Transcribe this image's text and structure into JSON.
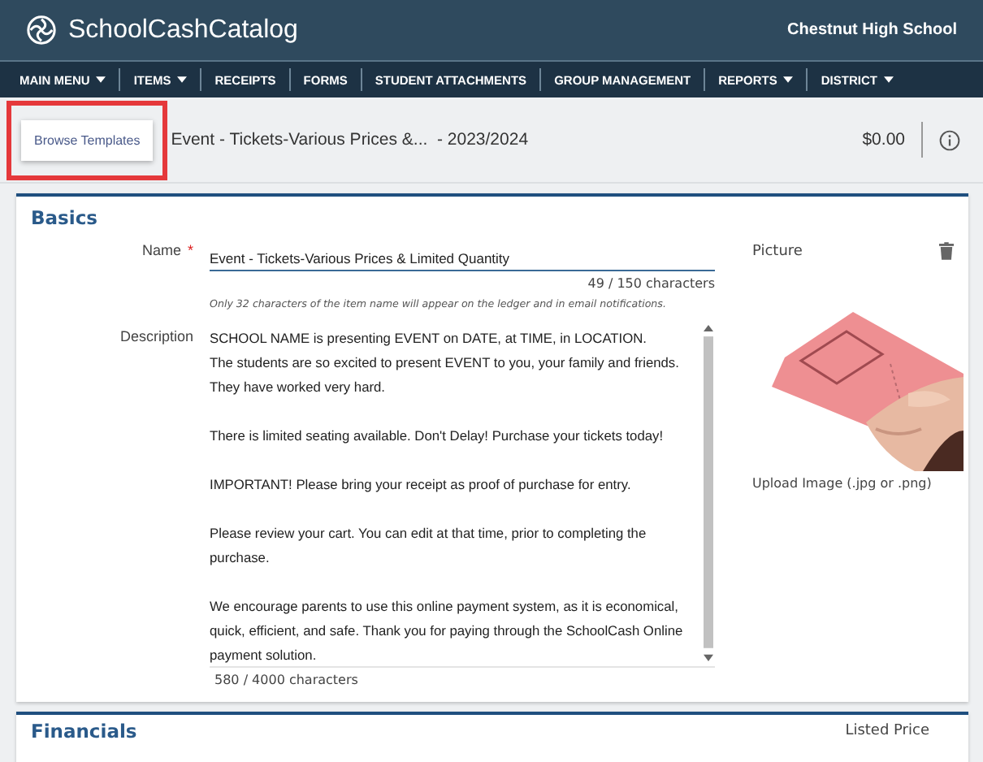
{
  "header": {
    "brand": "SchoolCashCatalog",
    "school": "Chestnut High School"
  },
  "nav": [
    {
      "label": "MAIN MENU",
      "dropdown": true
    },
    {
      "label": "ITEMS",
      "dropdown": true
    },
    {
      "label": "RECEIPTS",
      "dropdown": false
    },
    {
      "label": "FORMS",
      "dropdown": false
    },
    {
      "label": "STUDENT ATTACHMENTS",
      "dropdown": false
    },
    {
      "label": "GROUP MANAGEMENT",
      "dropdown": false
    },
    {
      "label": "REPORTS",
      "dropdown": true
    },
    {
      "label": "DISTRICT",
      "dropdown": true
    }
  ],
  "toolbar": {
    "browse_button": "Browse Templates",
    "highlighted": true,
    "item_title": "Event - Tickets-Various Prices &...  - 2023/2024",
    "total": "$0.00"
  },
  "basics": {
    "title": "Basics",
    "name_label": "Name",
    "required_mark": "*",
    "name_value": "Event - Tickets-Various Prices & Limited Quantity",
    "name_count": "49 / 150  characters",
    "name_hint": "Only 32 characters of the item name will appear on the ledger and in email notifications.",
    "description_label": "Description",
    "description_paragraphs": [
      [
        "SCHOOL NAME is presenting EVENT  on DATE, at TIME, in LOCATION.",
        "The students are so excited to present EVENT to you, your family and friends.",
        "They have worked very hard."
      ],
      [
        "There is limited seating available. Don't Delay! Purchase your tickets today!"
      ],
      [
        "IMPORTANT! Please bring your receipt as proof of purchase for entry."
      ],
      [
        "Please review your cart. You can edit at that time, prior to completing the",
        "purchase."
      ],
      [
        "We encourage parents to use this online payment system, as it is economical,",
        "quick, efficient, and safe. Thank you for paying through the SchoolCash Online",
        "payment solution."
      ]
    ],
    "description_count": "580 / 4000  characters",
    "picture_label": "Picture",
    "picture": {
      "kind": "picture"
    },
    "upload_hint": "Upload Image (.jpg or .png)"
  },
  "financials": {
    "title": "Financials",
    "listed_price_label": "Listed Price"
  }
}
